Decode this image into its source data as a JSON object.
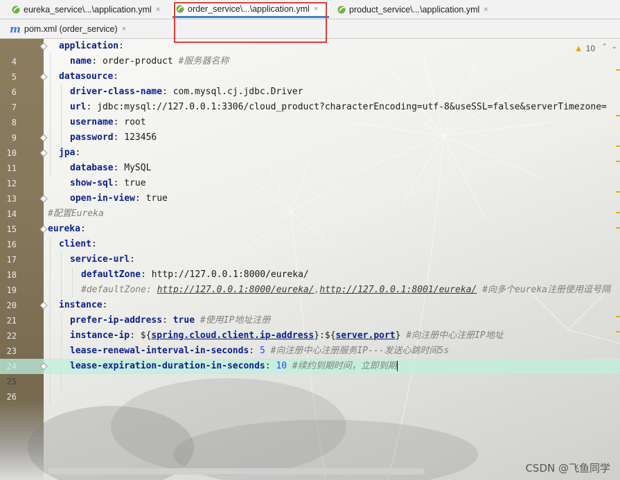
{
  "tabs": [
    {
      "label": "eureka_service\\...\\application.yml",
      "active": false
    },
    {
      "label": "order_service\\...\\application.yml",
      "active": true
    },
    {
      "label": "product_service\\...\\application.yml",
      "active": false
    }
  ],
  "tab_close_glyph": "×",
  "subtab": {
    "icon_letter": "m",
    "label": "pom.xml (order_service)"
  },
  "inspections": {
    "warning_count": "10",
    "up": "⌃",
    "down": "⌄"
  },
  "watermark": "CSDN @飞鱼同学",
  "lines": [
    {
      "n": "4"
    },
    {
      "n": "5"
    },
    {
      "n": "6"
    },
    {
      "n": "7"
    },
    {
      "n": "8"
    },
    {
      "n": "9"
    },
    {
      "n": "10"
    },
    {
      "n": "11"
    },
    {
      "n": "12"
    },
    {
      "n": "13"
    },
    {
      "n": "14"
    },
    {
      "n": "15"
    },
    {
      "n": "16"
    },
    {
      "n": "17"
    },
    {
      "n": "18"
    },
    {
      "n": "19"
    },
    {
      "n": "20"
    },
    {
      "n": "21"
    },
    {
      "n": "22"
    },
    {
      "n": "23"
    },
    {
      "n": "24"
    },
    {
      "n": "25"
    },
    {
      "n": "26"
    }
  ],
  "code": {
    "l4_key": "application",
    "l5_key": "name",
    "l5_val": "order-product",
    "l5_cmt": "#服务器名称",
    "l6_key": "datasource",
    "l7_key": "driver-class-name",
    "l7_val": "com.mysql.cj.jdbc.Driver",
    "l8_key": "url",
    "l8_val": "jdbc:mysql://127.0.0.1:3306/cloud_product?characterEncoding=utf-8&useSSL=false&serverTimezone=",
    "l9_key": "username",
    "l9_val": "root",
    "l10_key": "password",
    "l10_val": "123456",
    "l11_key": "jpa",
    "l12_key": "database",
    "l12_val": "MySQL",
    "l13_key": "show-sql",
    "l13_val": "true",
    "l14_key": "open-in-view",
    "l14_val": "true",
    "l15_cmt": "#配置Eureka",
    "l16_key": "eureka",
    "l17_key": "client",
    "l18_key": "service-url",
    "l19_key": "defaultZone",
    "l19_val": "http://127.0.0.1:8000/eureka/",
    "l20_pre": "#defaultZone: ",
    "l20_url1": "http://127.0.0.1:8000/eureka/",
    "l20_sep": ",",
    "l20_url2": "http://127.0.0.1:8001/eureka/",
    "l20_post": " #向多个eureka注册使用逗号隔",
    "l21_key": "instance",
    "l22_key": "prefer-ip-address",
    "l22_val": "true",
    "l22_cmt": "#使用IP地址注册",
    "l23_key": "instance-ip",
    "l23_p1": "${",
    "l23_ref1": "spring.cloud.client.ip-address",
    "l23_p2": "}:${",
    "l23_ref2": "server.port",
    "l23_p3": "}",
    "l23_cmt": "#向注册中心注册IP地址",
    "l24_key": "lease-renewal-interval-in-seconds",
    "l24_val": "5",
    "l24_cmt": "#向注册中心注册服务IP---发送心跳时间5s",
    "l25_key": "lease-expiration-duration-in-seconds",
    "l25_val": "10",
    "l25_cmt": "#续约到期时间，立即到期"
  },
  "colors": {
    "key": "#0a1f8a",
    "comment": "#808080",
    "number": "#1750eb",
    "current_line": "#bcf0de",
    "highlight_box": "#e53935",
    "active_tab_underline": "#4083c9"
  }
}
